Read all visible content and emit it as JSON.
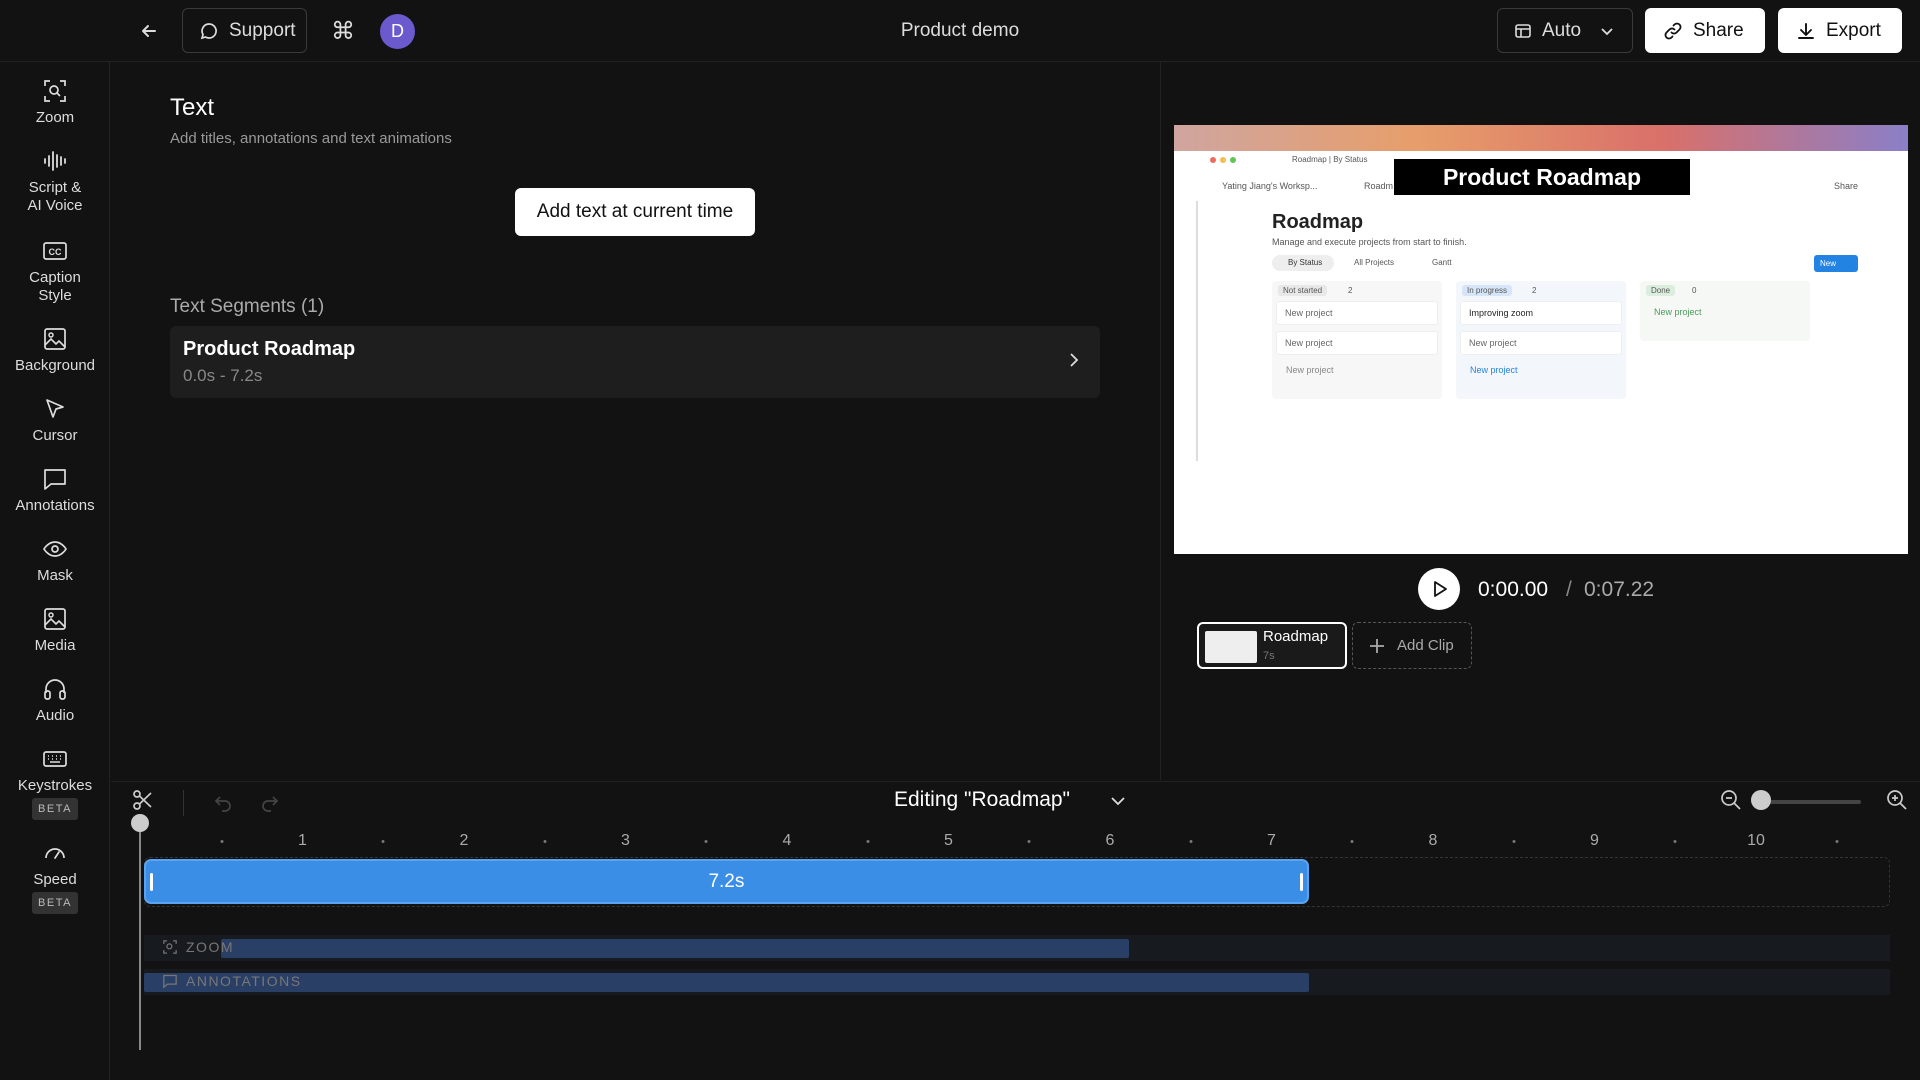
{
  "header": {
    "support_label": "Support",
    "cmd_symbol": "⌘",
    "avatar_initial": "D",
    "title": "Product demo",
    "auto_label": "Auto",
    "share_label": "Share",
    "export_label": "Export"
  },
  "sidebar": {
    "items": [
      {
        "label": "Zoom",
        "icon": "zoom-icon"
      },
      {
        "label": "Script &\nAI Voice",
        "icon": "waveform-icon"
      },
      {
        "label": "Caption\nStyle",
        "icon": "caption-icon"
      },
      {
        "label": "Background",
        "icon": "image-icon"
      },
      {
        "label": "Cursor",
        "icon": "cursor-icon"
      },
      {
        "label": "Annotations",
        "icon": "annotation-icon"
      },
      {
        "label": "Mask",
        "icon": "eye-icon"
      },
      {
        "label": "Media",
        "icon": "media-icon"
      },
      {
        "label": "Audio",
        "icon": "headphones-icon"
      },
      {
        "label": "Keystrokes",
        "icon": "keyboard-icon",
        "badge": "BETA"
      },
      {
        "label": "Speed",
        "icon": "gauge-icon",
        "badge": "BETA"
      }
    ]
  },
  "panel": {
    "title": "Text",
    "subtitle": "Add titles, annotations and text animations",
    "add_button": "Add text at current time",
    "segments_heading": "Text Segments (1)",
    "segments": [
      {
        "name": "Product Roadmap",
        "time": "0.0s - 7.2s"
      }
    ]
  },
  "preview": {
    "overlay_title": "Product Roadmap",
    "tab_label": "Roadmap | By Status",
    "workspace": "Yating Jiang's Worksp...",
    "crumb": "Roadm",
    "share": "Share",
    "page_title": "Roadmap",
    "page_sub": "Manage and execute projects from start to finish.",
    "views": [
      "By Status",
      "All Projects",
      "Gantt"
    ],
    "new_btn": "New",
    "columns": [
      {
        "status": "Not started",
        "count": "2",
        "cards": [
          "New project",
          "New project"
        ],
        "add": "New project"
      },
      {
        "status": "In progress",
        "count": "2",
        "cards": [
          "Improving zoom",
          "New project"
        ],
        "add": "New project"
      },
      {
        "status": "Done",
        "count": "0",
        "cards": [],
        "add": "New project"
      }
    ]
  },
  "transport": {
    "current": "0:00.00",
    "separator": "/",
    "total": "0:07.22"
  },
  "clips": [
    {
      "name": "Roadmap",
      "duration": "7s"
    }
  ],
  "add_clip_label": "Add Clip",
  "timeline": {
    "editing_label": "Editing \"Roadmap\"",
    "ruler": [
      "1",
      "2",
      "3",
      "4",
      "5",
      "6",
      "7",
      "8",
      "9",
      "10"
    ],
    "clip_label": "7.2s",
    "clip_duration_s": 7.2,
    "lanes": [
      {
        "label": "ZOOM",
        "icon": "zoom-icon",
        "end_s": 6.1
      },
      {
        "label": "ANNOTATIONS",
        "icon": "annotation-icon",
        "end_s": 7.2
      }
    ]
  }
}
